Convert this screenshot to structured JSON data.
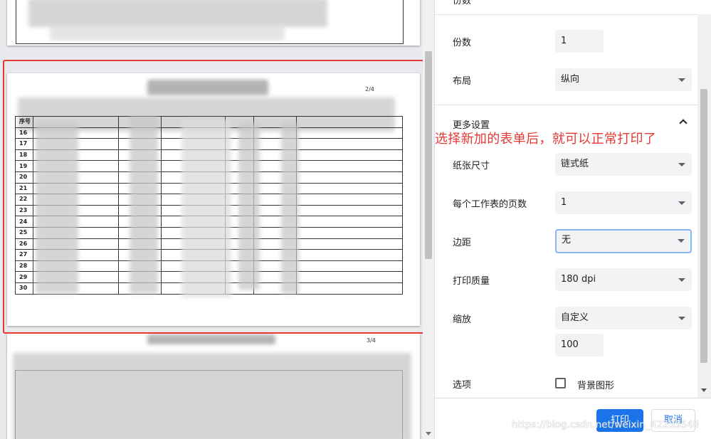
{
  "preview": {
    "page_2": {
      "page_number": "2/4",
      "header_cell": "序号",
      "rows": [
        "16",
        "17",
        "18",
        "19",
        "20",
        "21",
        "22",
        "23",
        "24",
        "25",
        "26",
        "27",
        "28",
        "29",
        "30"
      ]
    },
    "page_3": {
      "page_number": "3/4"
    }
  },
  "settings": {
    "top_label": "份数",
    "copies": {
      "label": "份数",
      "value": "1"
    },
    "layout": {
      "label": "布局",
      "value": "纵向"
    },
    "more_settings": {
      "label": "更多设置"
    },
    "paper_size": {
      "label": "纸张尺寸",
      "value": "链式纸"
    },
    "pages_per_sheet": {
      "label": "每个工作表的页数",
      "value": "1"
    },
    "margins": {
      "label": "边距",
      "value": "无"
    },
    "quality": {
      "label": "打印质量",
      "value": "180 dpi"
    },
    "scale": {
      "label": "缩放",
      "value": "自定义",
      "custom_value": "100"
    },
    "options": {
      "label": "选项",
      "background_graphics": "背景图形",
      "background_checked": false
    }
  },
  "buttons": {
    "print": "打印",
    "cancel": "取消"
  },
  "annotation": "选择新加的表单后，就可以正常打印了",
  "watermark": "https://blog.csdn.net/weixin_42255548",
  "colors": {
    "accent": "#1a73e8",
    "annotation_red": "#e53935"
  }
}
